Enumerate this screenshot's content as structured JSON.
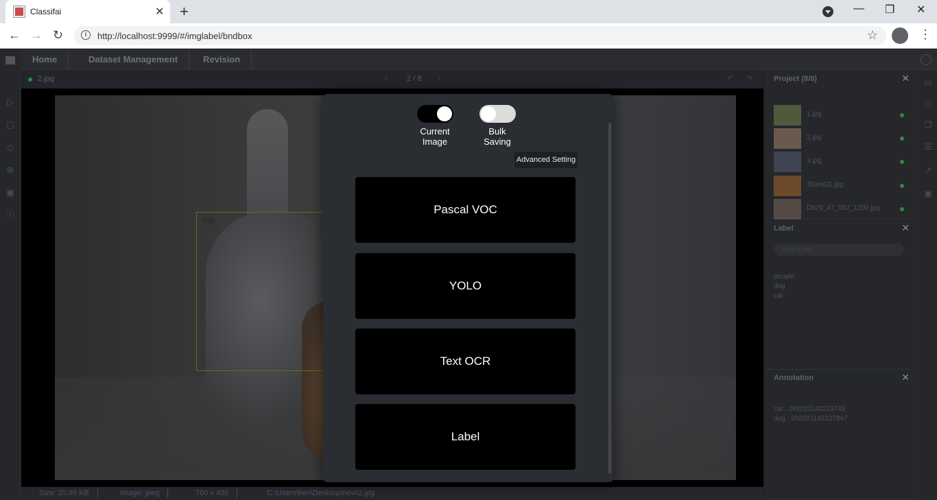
{
  "browser": {
    "tab_title": "Classifai",
    "url": "http://localhost:9999/#/imglabel/bndbox"
  },
  "menu": {
    "items": [
      "Home",
      "Dataset Management",
      "Revision"
    ]
  },
  "image_bar": {
    "file_name": "2.jpg",
    "pager": "2 / 8"
  },
  "canvas": {
    "bbox_label": "cat"
  },
  "status": {
    "size": "Size: 20.96 KB",
    "type": "Image: jpeg",
    "dims": "760 x 430",
    "path": "C:\\Users\\ken\\Desktop\\new\\2.jpg"
  },
  "project_panel": {
    "title": "Project (8/8)",
    "files": [
      "1.jpg",
      "2.jpg",
      "3.jpg",
      "3DenG5.jpg",
      "D929_47_552_1200.jpg"
    ]
  },
  "label_panel": {
    "title": "Label",
    "placeholder": "Enter Label",
    "labels": [
      "people",
      "dog",
      "cat"
    ]
  },
  "annotation_panel": {
    "title": "Annotation",
    "items": [
      "cat : 262021142223743",
      "dog : 262021142227867"
    ]
  },
  "modal": {
    "toggle1": {
      "line1": "Current",
      "line2": "Image",
      "on": true
    },
    "toggle2": {
      "line1": "Bulk",
      "line2": "Saving",
      "on": false
    },
    "advanced_label": "Advanced Setting",
    "buttons": [
      "Pascal VOC",
      "YOLO",
      "Text OCR",
      "Label"
    ]
  }
}
